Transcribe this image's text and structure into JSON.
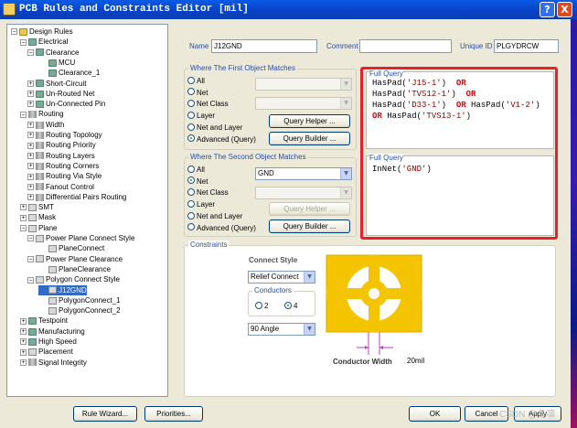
{
  "window": {
    "title": "PCB Rules and Constraints Editor [mil]",
    "help_label": "?",
    "close_label": "X"
  },
  "tree": {
    "nodes": [
      {
        "label": "Design Rules",
        "expander": "−",
        "icon": "folder"
      },
      {
        "label": "Electrical",
        "expander": "−",
        "icon": "rule"
      },
      {
        "label": "Clearance",
        "expander": "−",
        "icon": "rule"
      },
      {
        "label": "MCU",
        "expander": "",
        "icon": "rule"
      },
      {
        "label": "Clearance_1",
        "expander": "",
        "icon": "rule"
      },
      {
        "label": "Short-Circuit",
        "expander": "+",
        "icon": "rule"
      },
      {
        "label": "Un-Routed Net",
        "expander": "+",
        "icon": "rule"
      },
      {
        "label": "Un-Connected Pin",
        "expander": "+",
        "icon": "rule"
      },
      {
        "label": "Routing",
        "expander": "−",
        "icon": "wave"
      },
      {
        "label": "Width",
        "expander": "+",
        "icon": "wave"
      },
      {
        "label": "Routing Topology",
        "expander": "+",
        "icon": "wave"
      },
      {
        "label": "Routing Priority",
        "expander": "+",
        "icon": "wave"
      },
      {
        "label": "Routing Layers",
        "expander": "+",
        "icon": "wave"
      },
      {
        "label": "Routing Corners",
        "expander": "+",
        "icon": "wave"
      },
      {
        "label": "Routing Via Style",
        "expander": "+",
        "icon": "wave"
      },
      {
        "label": "Fanout Control",
        "expander": "+",
        "icon": "wave"
      },
      {
        "label": "Differential Pairs Routing",
        "expander": "+",
        "icon": "wave"
      },
      {
        "label": "SMT",
        "expander": "+",
        "icon": "plane"
      },
      {
        "label": "Mask",
        "expander": "+",
        "icon": "plane"
      },
      {
        "label": "Plane",
        "expander": "−",
        "icon": "plane"
      },
      {
        "label": "Power Plane Connect Style",
        "expander": "−",
        "icon": "plane"
      },
      {
        "label": "PlaneConnect",
        "expander": "",
        "icon": "plane"
      },
      {
        "label": "Power Plane Clearance",
        "expander": "−",
        "icon": "plane"
      },
      {
        "label": "PlaneClearance",
        "expander": "",
        "icon": "plane"
      },
      {
        "label": "Polygon Connect Style",
        "expander": "−",
        "icon": "plane"
      },
      {
        "label": "J12GND",
        "expander": "",
        "icon": "plane",
        "selected": true
      },
      {
        "label": "PolygonConnect_1",
        "expander": "",
        "icon": "plane"
      },
      {
        "label": "PolygonConnect_2",
        "expander": "",
        "icon": "plane"
      },
      {
        "label": "Testpoint",
        "expander": "+",
        "icon": "rule"
      },
      {
        "label": "Manufacturing",
        "expander": "+",
        "icon": "rule"
      },
      {
        "label": "High Speed",
        "expander": "+",
        "icon": "rule"
      },
      {
        "label": "Placement",
        "expander": "+",
        "icon": "plane"
      },
      {
        "label": "Signal Integrity",
        "expander": "+",
        "icon": "wave"
      }
    ]
  },
  "rule": {
    "name_label": "Name",
    "name_value": "J12GND",
    "comment_label": "Comment",
    "comment_value": "",
    "uid_label": "Unique ID",
    "uid_value": "PLGYDRCW"
  },
  "first_match": {
    "title": "Where The First Object Matches",
    "options": [
      "All",
      "Net",
      "Net Class",
      "Layer",
      "Net and Layer",
      "Advanced (Query)"
    ],
    "selected": "Advanced (Query)",
    "query_helper": "Query Helper ...",
    "query_builder": "Query Builder ..."
  },
  "second_match": {
    "title": "Where The Second Object Matches",
    "options": [
      "All",
      "Net",
      "Net Class",
      "Layer",
      "Net and Layer",
      "Advanced (Query)"
    ],
    "selected": "Net",
    "net_value": "GND",
    "query_helper": "Query Helper ...",
    "query_builder": "Query Builder ..."
  },
  "full_query_1": {
    "title": "Full Query",
    "lines": [
      [
        {
          "t": "HasPad(",
          "c": ""
        },
        {
          "t": "'J15-1'",
          "c": "str"
        },
        {
          "t": ")  ",
          "c": ""
        },
        {
          "t": "OR",
          "c": "kw"
        }
      ],
      [
        {
          "t": "HasPad(",
          "c": ""
        },
        {
          "t": "'TVS12-1'",
          "c": "str"
        },
        {
          "t": ")  ",
          "c": ""
        },
        {
          "t": "OR",
          "c": "kw"
        }
      ],
      [
        {
          "t": "HasPad(",
          "c": ""
        },
        {
          "t": "'D33-1'",
          "c": "str"
        },
        {
          "t": ")  ",
          "c": ""
        },
        {
          "t": "OR",
          "c": "kw"
        },
        {
          "t": " HasPad(",
          "c": ""
        },
        {
          "t": "'V1-2'",
          "c": "str"
        },
        {
          "t": ")",
          "c": ""
        }
      ],
      [
        {
          "t": "OR",
          "c": "kw"
        },
        {
          "t": " HasPad(",
          "c": ""
        },
        {
          "t": "'TVS13-1'",
          "c": "str"
        },
        {
          "t": ")",
          "c": ""
        }
      ]
    ]
  },
  "full_query_2": {
    "title": "Full Query",
    "lines": [
      [
        {
          "t": "InNet(",
          "c": ""
        },
        {
          "t": "'GND'",
          "c": "str"
        },
        {
          "t": ")",
          "c": ""
        }
      ]
    ]
  },
  "constraints": {
    "title": "Constraints",
    "connect_style_label": "Connect Style",
    "connect_style_value": "Relief Connect",
    "conductors_label": "Conductors",
    "conductor_options": [
      "2",
      "4"
    ],
    "conductor_selected": "4",
    "angle_value": "90 Angle",
    "conductor_width_label": "Conductor Width",
    "conductor_width_value": "20mil",
    "colors": {
      "pad": "#f5c400",
      "pad_border": "#d9a800",
      "thermal_gap": "#ffffff",
      "dimension": "#c040c0"
    }
  },
  "buttons": {
    "rule_wizard": "Rule Wizard...",
    "priorities": "Priorities...",
    "ok": "OK",
    "cancel": "Cancel",
    "apply": "Apply"
  },
  "watermark": "CSDN @冬凛"
}
